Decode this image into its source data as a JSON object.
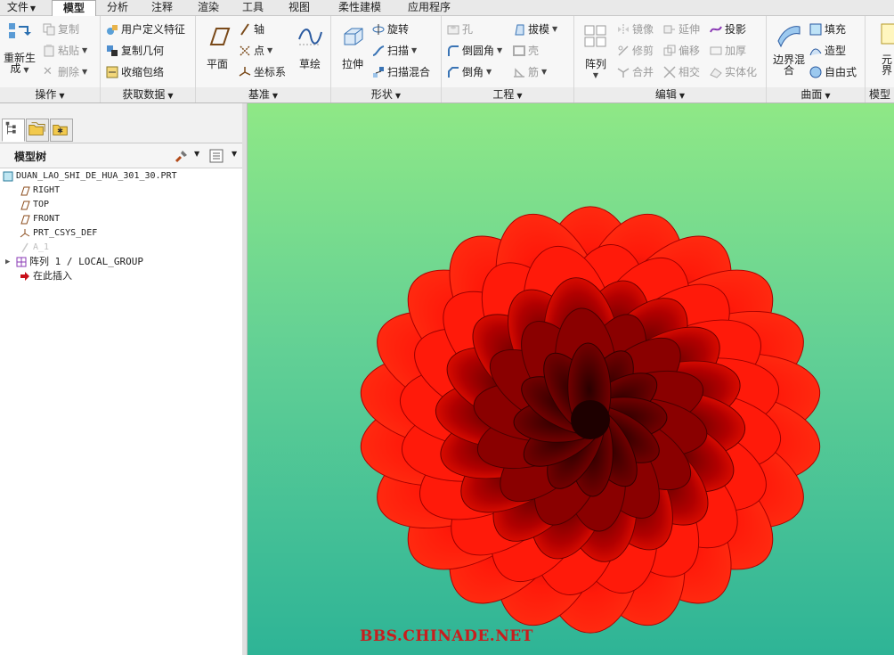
{
  "menu": {
    "file": "文件",
    "tabs": [
      "模型",
      "分析",
      "注释",
      "渲染",
      "工具",
      "视图",
      "柔性建模",
      "应用程序"
    ]
  },
  "ribbon": {
    "ops": {
      "regen": "重新生成",
      "copy": "复制",
      "paste": "粘贴",
      "delete": "删除",
      "label": "操作"
    },
    "getdata": {
      "udf": "用户定义特征",
      "copygeom": "复制几何",
      "shrinkwrap": "收缩包络",
      "label": "获取数据"
    },
    "datum": {
      "plane": "平面",
      "axis": "轴",
      "point": "点",
      "csys": "坐标系",
      "sketch": "草绘",
      "label": "基准"
    },
    "shape": {
      "extrude": "拉伸",
      "revolve": "旋转",
      "sweep": "扫描",
      "sweptblend": "扫描混合",
      "label": "形状"
    },
    "eng": {
      "hole": "孔",
      "round": "倒圆角",
      "chamfer": "倒角",
      "draft": "拔模",
      "shell": "壳",
      "rib": "筋",
      "label": "工程"
    },
    "edit": {
      "pattern": "阵列",
      "mirror": "镜像",
      "trim": "修剪",
      "merge": "合并",
      "extend": "延伸",
      "offset": "偏移",
      "intersect": "相交",
      "project": "投影",
      "thicken": "加厚",
      "solidify": "实体化",
      "label": "编辑"
    },
    "surface": {
      "boundary": "边界混合",
      "fill": "填充",
      "style": "造型",
      "freestyle": "自由式",
      "label": "曲面"
    },
    "intent": {
      "element": "元界",
      "label": "模型意"
    }
  },
  "panel": {
    "title": "模型树",
    "items": [
      {
        "label": "DUAN_LAO_SHI_DE_HUA_301_30.PRT",
        "icon": "part-icon"
      },
      {
        "label": "RIGHT",
        "icon": "datum-plane-icon"
      },
      {
        "label": "TOP",
        "icon": "datum-plane-icon"
      },
      {
        "label": "FRONT",
        "icon": "datum-plane-icon"
      },
      {
        "label": "PRT_CSYS_DEF",
        "icon": "csys-icon"
      },
      {
        "label": "A_1",
        "icon": "axis-icon"
      },
      {
        "label": "阵列 1 / LOCAL_GROUP",
        "icon": "pattern-icon"
      },
      {
        "label": "在此插入",
        "icon": "insert-arrow-icon"
      }
    ]
  },
  "viewport": {
    "watermark": "BBS.CHINADE.NET"
  },
  "colors": {
    "flower": "#ff1a0a",
    "bg_top": "#8fe886",
    "bg_bottom": "#2eb496"
  }
}
